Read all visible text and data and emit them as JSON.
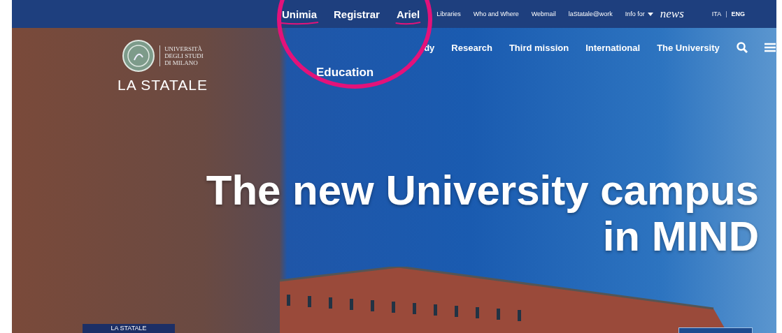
{
  "top_bar": {
    "links": [
      {
        "label": "Unimia",
        "kind": "portal",
        "underlined": true
      },
      {
        "label": "Registrar",
        "kind": "portal",
        "underlined": false
      },
      {
        "label": "Ariel",
        "kind": "portal",
        "underlined": true
      },
      {
        "label": "Libraries",
        "kind": "link"
      },
      {
        "label": "Who and Where",
        "kind": "link"
      },
      {
        "label": "Webmail",
        "kind": "link"
      },
      {
        "label": "laStatale@work",
        "kind": "link"
      },
      {
        "label": "Info for",
        "kind": "dropdown"
      },
      {
        "label": "news",
        "kind": "brand"
      }
    ],
    "language_separator": "|",
    "languages": [
      {
        "label": "ITA",
        "selected": false
      },
      {
        "label": "ENG",
        "selected": true
      }
    ]
  },
  "logo": {
    "lines": [
      "UNIVERSITÀ",
      "DEGLI STUDI",
      "DI MILANO"
    ],
    "name": "LA STATALE"
  },
  "main_nav": {
    "dropdown_item": "Education",
    "items": [
      "dy",
      "Research",
      "Third mission",
      "International",
      "The University"
    ]
  },
  "hero": {
    "headline": [
      "The new University campus",
      "in MIND"
    ],
    "badge": "LA STATALE"
  },
  "annotation": {
    "circle": true
  }
}
